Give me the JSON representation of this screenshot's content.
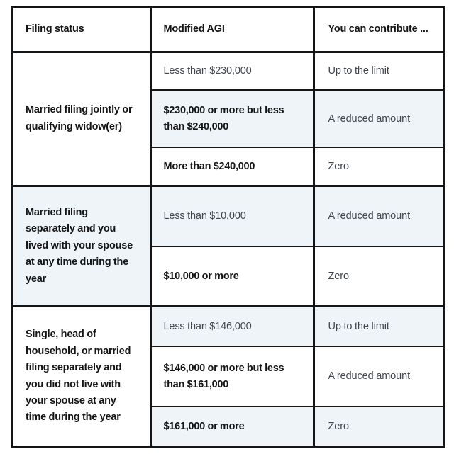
{
  "table": {
    "headers": [
      "Filing status",
      "Modified AGI",
      "You can contribute ..."
    ],
    "groups": [
      {
        "filing_status": "Married filing jointly or qualifying widow(er)",
        "status_shaded": false,
        "rows": [
          {
            "agi": "Less than $230,000",
            "agi_bold": false,
            "contribution": "Up to the limit",
            "shaded": false
          },
          {
            "agi": "$230,000 or more but less than $240,000",
            "agi_bold": true,
            "contribution": "A reduced amount",
            "shaded": true
          },
          {
            "agi": "More than $240,000",
            "agi_bold": true,
            "contribution": "Zero",
            "shaded": false
          }
        ]
      },
      {
        "filing_status": "Married filing separately and you lived with your spouse at any time during the year",
        "status_shaded": true,
        "rows": [
          {
            "agi": "Less than $10,000",
            "agi_bold": false,
            "contribution": "A reduced amount",
            "shaded": true
          },
          {
            "agi": "$10,000 or more",
            "agi_bold": true,
            "contribution": "Zero",
            "shaded": false
          }
        ]
      },
      {
        "filing_status": "Single, head of household, or married filing separately and you did not live with your spouse at any time during the year",
        "status_shaded": false,
        "rows": [
          {
            "agi": "Less than $146,000",
            "agi_bold": false,
            "contribution": "Up to the limit",
            "shaded": true
          },
          {
            "agi": "$146,000 or more but less than $161,000",
            "agi_bold": true,
            "contribution": "A reduced amount",
            "shaded": false
          },
          {
            "agi": "$161,000 or more",
            "agi_bold": true,
            "contribution": "Zero",
            "shaded": true
          }
        ]
      }
    ],
    "colors": {
      "border": "#131516",
      "shade": "#eef4f8",
      "text_strong": "#131516",
      "text_muted": "#3f464c",
      "background": "#ffffff"
    }
  }
}
